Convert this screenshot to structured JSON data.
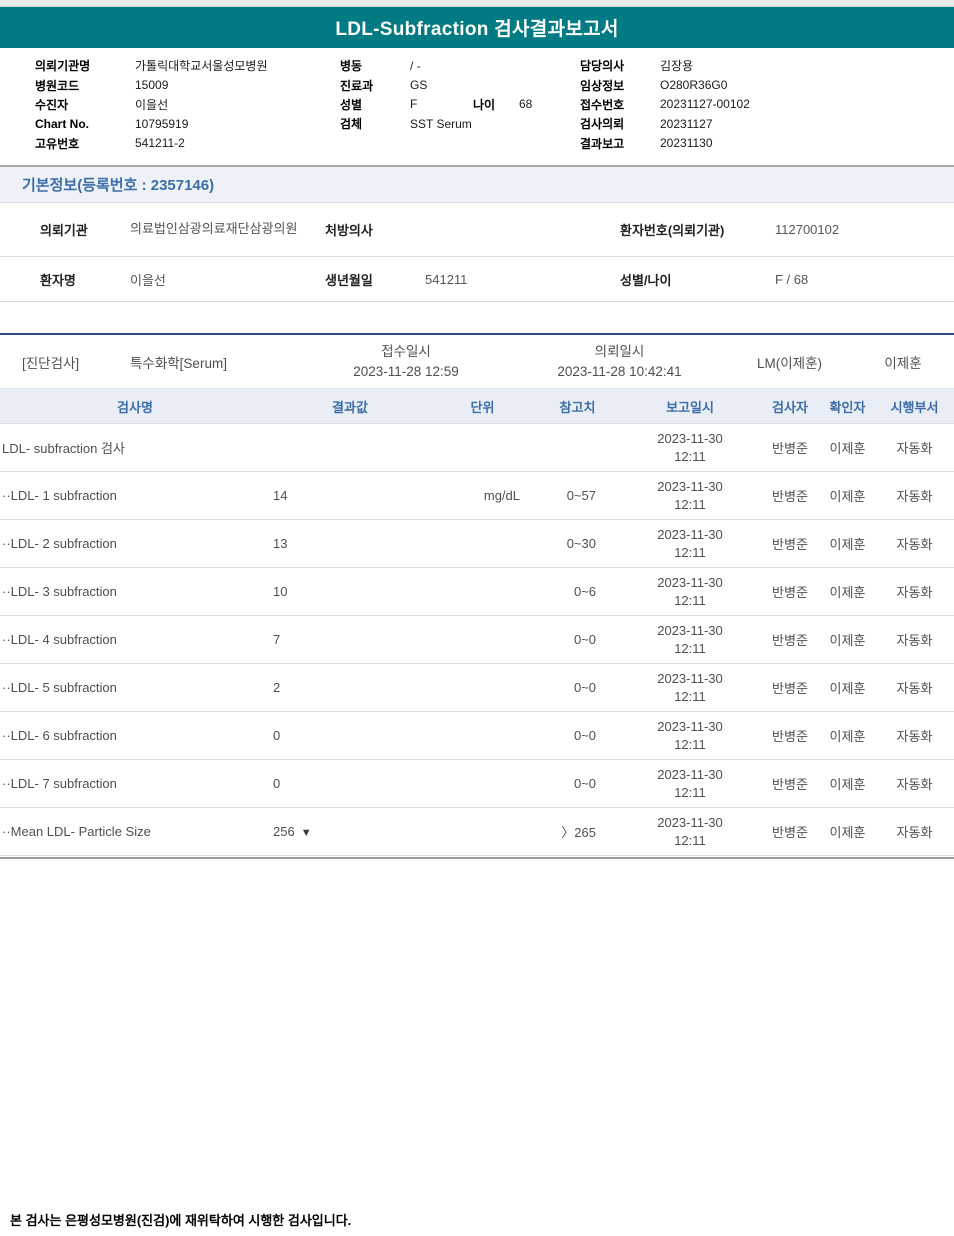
{
  "title": "LDL-Subfraction 검사결과보고서",
  "colors": {
    "header_teal": "#007b83",
    "accent_blue": "#3c6da8",
    "section_line_navy": "#2d4e81",
    "header_band_bg": "#e9eef6",
    "divider_gray": "#9b9b9b"
  },
  "patient_header": {
    "left": [
      {
        "label": "의뢰기관명",
        "value": "가톨릭대학교서울성모병원"
      },
      {
        "label": "병원코드",
        "value": "15009"
      },
      {
        "label": "수진자",
        "value": "이을선"
      },
      {
        "label": "Chart No.",
        "value": "10795919"
      },
      {
        "label": "고유번호",
        "value": "541211-2"
      }
    ],
    "middle": {
      "ward_label": "병동",
      "ward_value": "/ -",
      "dept_label": "진료과",
      "dept_value": "GS",
      "sex_label": "성별",
      "sex_value": "F",
      "age_label": "나이",
      "age_value": "68",
      "specimen_label": "검체",
      "specimen_value": "SST Serum"
    },
    "right": [
      {
        "label": "담당의사",
        "value": "김장용"
      },
      {
        "label": "임상정보",
        "value": "O280R36G0"
      },
      {
        "label": "접수번호",
        "value": "20231127-00102"
      },
      {
        "label": "검사의뢰",
        "value": "20231127"
      },
      {
        "label": "결과보고",
        "value": "20231130"
      }
    ]
  },
  "basic_info": {
    "section_title": "기본정보(등록번호 : 2357146)",
    "row1": {
      "l1": "의뢰기관",
      "v1": "의료법인삼광의료재단삼광의원",
      "l2": "처방의사",
      "v2": "",
      "l3": "환자번호(의뢰기관)",
      "v3": "112700102"
    },
    "row2": {
      "l1": "환자명",
      "v1": "이을선",
      "l2": "생년월일",
      "v2": "541211",
      "l3": "성별/나이",
      "v3": "F / 68"
    }
  },
  "results": {
    "section": {
      "category": "[진단검사]",
      "group": "특수화학[Serum]",
      "receipt_label": "접수일시",
      "receipt_datetime": "2023-11-28 12:59",
      "request_label": "의뢰일시",
      "request_datetime": "2023-11-28 10:42:41",
      "lm": "LM(이제훈)",
      "person": "이제훈"
    },
    "columns": [
      "검사명",
      "결과값",
      "단위",
      "참고치",
      "보고일시",
      "검사자",
      "확인자",
      "시행부서"
    ],
    "rows": [
      {
        "name": "LDL- subfraction 검사",
        "result": "",
        "flag": "",
        "unit": "",
        "ref": "",
        "report_date": "2023-11-30",
        "report_time": "12:11",
        "examiner": "반병준",
        "confirmer": "이제훈",
        "dept": "자동화"
      },
      {
        "name": "··LDL- 1 subfraction",
        "result": "14",
        "flag": "",
        "unit": "mg/dL",
        "ref": "0~57",
        "report_date": "2023-11-30",
        "report_time": "12:11",
        "examiner": "반병준",
        "confirmer": "이제훈",
        "dept": "자동화"
      },
      {
        "name": "··LDL- 2 subfraction",
        "result": "13",
        "flag": "",
        "unit": "",
        "ref": "0~30",
        "report_date": "2023-11-30",
        "report_time": "12:11",
        "examiner": "반병준",
        "confirmer": "이제훈",
        "dept": "자동화"
      },
      {
        "name": "··LDL- 3 subfraction",
        "result": "10",
        "flag": "",
        "unit": "",
        "ref": "0~6",
        "report_date": "2023-11-30",
        "report_time": "12:11",
        "examiner": "반병준",
        "confirmer": "이제훈",
        "dept": "자동화"
      },
      {
        "name": "··LDL- 4 subfraction",
        "result": "7",
        "flag": "",
        "unit": "",
        "ref": "0~0",
        "report_date": "2023-11-30",
        "report_time": "12:11",
        "examiner": "반병준",
        "confirmer": "이제훈",
        "dept": "자동화"
      },
      {
        "name": "··LDL- 5 subfraction",
        "result": "2",
        "flag": "",
        "unit": "",
        "ref": "0~0",
        "report_date": "2023-11-30",
        "report_time": "12:11",
        "examiner": "반병준",
        "confirmer": "이제훈",
        "dept": "자동화"
      },
      {
        "name": "··LDL- 6 subfraction",
        "result": "0",
        "flag": "",
        "unit": "",
        "ref": "0~0",
        "report_date": "2023-11-30",
        "report_time": "12:11",
        "examiner": "반병준",
        "confirmer": "이제훈",
        "dept": "자동화"
      },
      {
        "name": "··LDL- 7 subfraction",
        "result": "0",
        "flag": "",
        "unit": "",
        "ref": "0~0",
        "report_date": "2023-11-30",
        "report_time": "12:11",
        "examiner": "반병준",
        "confirmer": "이제훈",
        "dept": "자동화"
      },
      {
        "name": "··Mean LDL- Particle Size",
        "result": "256",
        "flag": "▼",
        "unit": "",
        "ref": "〉265",
        "report_date": "2023-11-30",
        "report_time": "12:11",
        "examiner": "반병준",
        "confirmer": "이제훈",
        "dept": "자동화"
      }
    ]
  },
  "footer": {
    "note": "본 검사는 은평성모병원(진검)에 재위탁하여 시행한 검사입니다."
  }
}
